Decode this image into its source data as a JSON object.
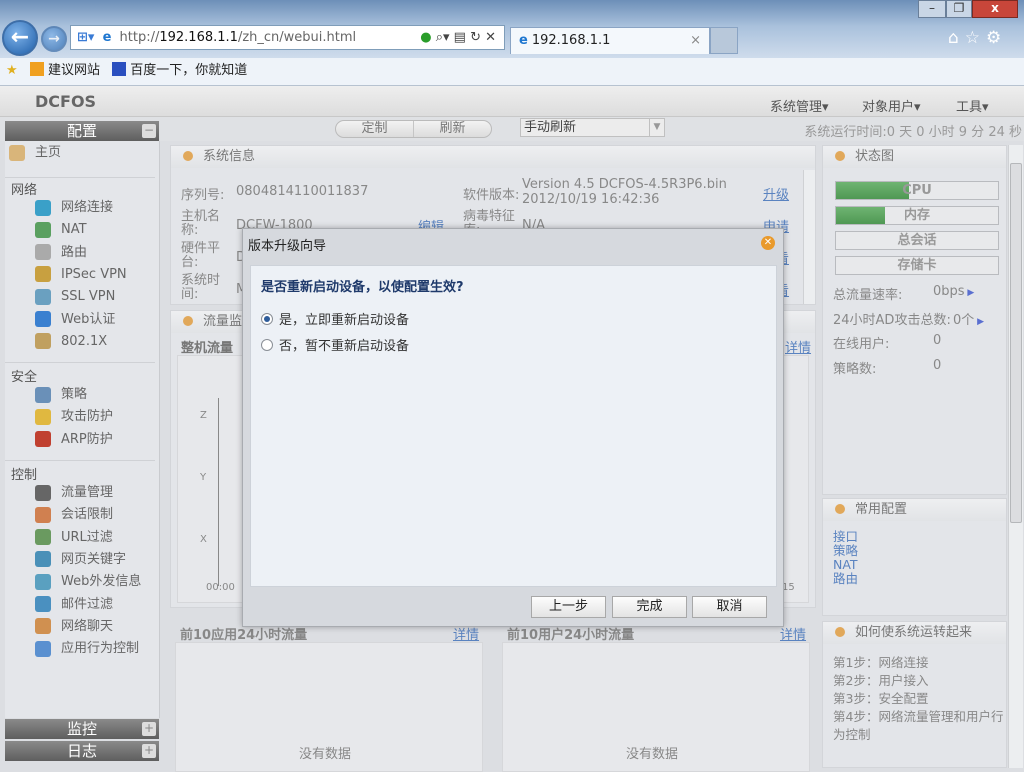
{
  "browser": {
    "url_prefix": "http://",
    "url_host": "192.168.1.1",
    "url_path": "/zh_cn/webui.html",
    "tab_title": "192.168.1.1",
    "tab_close": "×",
    "favorites": [
      {
        "label": "建议网站"
      },
      {
        "label": "百度一下，你就知道"
      }
    ]
  },
  "app": {
    "logo": "DCFOS",
    "menus": [
      "系统管理▾",
      "对象用户▾",
      "工具▾"
    ],
    "toolbar": {
      "customize": "定制",
      "refresh": "刷新",
      "refresh_mode": "手动刷新",
      "uptime": "系统运行时间:0 天 0 小时 9 分 24 秒"
    }
  },
  "sidebar": {
    "config": "配置",
    "home": "主页",
    "sections": [
      {
        "title": "网络",
        "items": [
          "网络连接",
          "NAT",
          "路由",
          "IPSec VPN",
          "SSL VPN",
          "Web认证",
          "802.1X"
        ]
      },
      {
        "title": "安全",
        "items": [
          "策略",
          "攻击防护",
          "ARP防护"
        ]
      },
      {
        "title": "控制",
        "items": [
          "流量管理",
          "会话限制",
          "URL过滤",
          "网页关键字",
          "Web外发信息",
          "邮件过滤",
          "网络聊天",
          "应用行为控制"
        ]
      }
    ],
    "monitor": "监控",
    "log": "日志"
  },
  "sysinfo": {
    "title": "系统信息",
    "serial_label": "序列号:",
    "serial": "0804814110011837",
    "sw_label": "软件版本:",
    "sw_version": "Version 4.5 DCFOS-4.5R3P6.bin",
    "sw_date": "2012/10/19 16:42:36",
    "upgrade": "升级",
    "host_label": "主机名称:",
    "host": "DCFW-1800",
    "edit": "编辑",
    "virus_label": "病毒特征库:",
    "virus": "N/A",
    "apply": "申请",
    "hw_label": "硬件平台:",
    "hw": "D",
    "time_label": "系统时间:",
    "time": "M",
    "view1": "查看",
    "view2": "查看"
  },
  "flow": {
    "title": "流量监控",
    "chart_title": "整机流量",
    "details": "详情",
    "y_ticks": [
      "Z",
      "Y",
      "X"
    ],
    "x_start": "00:00",
    "x_end": "15"
  },
  "top_apps": {
    "title": "前10应用24小时流量",
    "details": "详情",
    "empty": "没有数据"
  },
  "top_users": {
    "title": "前10用户24小时流量",
    "details": "详情",
    "empty": "没有数据"
  },
  "status": {
    "title": "状态图",
    "bars": [
      {
        "label": "CPU",
        "fill": 0.45
      },
      {
        "label": "内存",
        "fill": 0.3
      },
      {
        "label": "总会话",
        "fill": 0
      },
      {
        "label": "存储卡",
        "fill": 0
      }
    ],
    "stats": [
      {
        "label": "总流量速率:",
        "value": "0bps"
      },
      {
        "label": "24小时AD攻击总数:",
        "value": "0个"
      },
      {
        "label": "在线用户:",
        "value": "0"
      },
      {
        "label": "策略数:",
        "value": "0"
      }
    ]
  },
  "common": {
    "title": "常用配置",
    "links": [
      "接口",
      "策略",
      "NAT",
      "路由"
    ]
  },
  "howto": {
    "title": "如何使系统运转起来",
    "steps": [
      "第1步：网络连接",
      "第2步：用户接入",
      "第3步：安全配置",
      "第4步：网络流量管理和用户行为控制"
    ]
  },
  "dialog": {
    "title": "版本升级向导",
    "question": "是否重新启动设备，以使配置生效?",
    "options": [
      {
        "label": "是，立即重新启动设备",
        "selected": true
      },
      {
        "label": "否，暂不重新启动设备",
        "selected": false
      }
    ],
    "prev": "上一步",
    "finish": "完成",
    "cancel": "取消"
  }
}
